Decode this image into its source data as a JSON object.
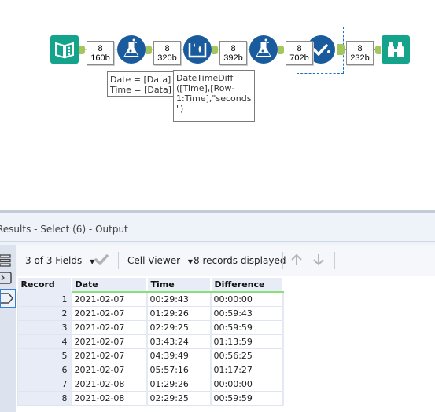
{
  "canvas": {
    "tools": [
      {
        "name": "input-data-tool",
        "icon": "book-icon"
      },
      {
        "name": "formula-tool-1",
        "icon": "flask-icon"
      },
      {
        "name": "multi-row-formula-tool",
        "icon": "drops-icon"
      },
      {
        "name": "formula-tool-2",
        "icon": "flask-icon"
      },
      {
        "name": "select-tool",
        "icon": "checkmark-icon"
      },
      {
        "name": "browse-tool",
        "icon": "binoculars-icon"
      }
    ],
    "connections": [
      {
        "records": "8",
        "size": "160b"
      },
      {
        "records": "8",
        "size": "320b"
      },
      {
        "records": "8",
        "size": "392b"
      },
      {
        "records": "8",
        "size": "702b"
      },
      {
        "records": "8",
        "size": "232b"
      }
    ],
    "annotations": [
      {
        "lines": [
          "Date = [Data]",
          "Time = [Data]"
        ]
      },
      {
        "lines": [
          "DateTimeDiff",
          "([Time],[Row-",
          "1:Time],\"seconds",
          "\")"
        ]
      }
    ]
  },
  "results": {
    "title": "Results - Select (6) - Output",
    "toolbar": {
      "fields_label": "3 of 3 Fields",
      "cell_viewer_label": "Cell Viewer",
      "records_displayed": "8 records displayed"
    },
    "columns": [
      "Record",
      "Date",
      "Time",
      "Difference"
    ],
    "rows": [
      [
        "1",
        "2021-02-07",
        "00:29:43",
        "00:00:00"
      ],
      [
        "2",
        "2021-02-07",
        "01:29:26",
        "00:59:43"
      ],
      [
        "3",
        "2021-02-07",
        "02:29:25",
        "00:59:59"
      ],
      [
        "4",
        "2021-02-07",
        "03:43:24",
        "01:13:59"
      ],
      [
        "5",
        "2021-02-07",
        "04:39:49",
        "00:56:25"
      ],
      [
        "6",
        "2021-02-07",
        "05:57:16",
        "01:17:27"
      ],
      [
        "7",
        "2021-02-08",
        "01:29:26",
        "00:00:00"
      ],
      [
        "8",
        "2021-02-08",
        "02:29:25",
        "00:59:59"
      ]
    ]
  },
  "colors": {
    "tool_blue": "#1a5b9e",
    "tool_teal": "#14a38b",
    "anchor_green": "#a4c65a",
    "header_green_underline": "#8bdf7a",
    "selection_blue": "#1f6fc7"
  }
}
